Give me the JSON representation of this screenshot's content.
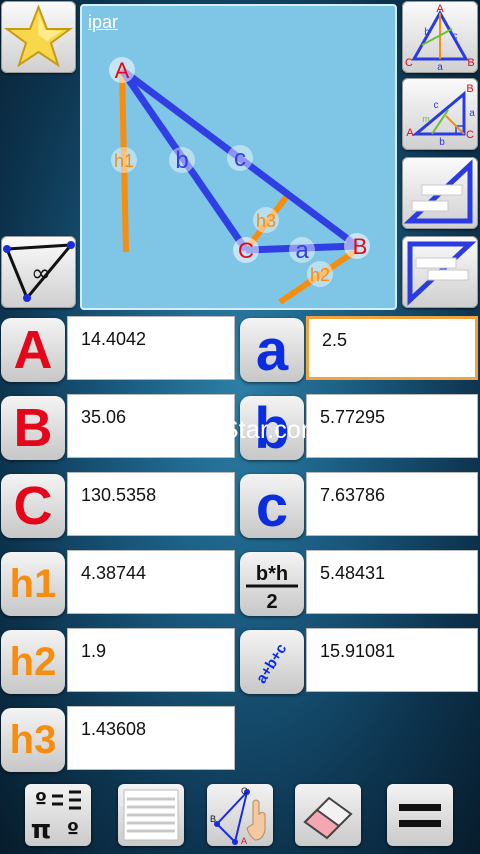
{
  "canvas": {
    "title": "ipar",
    "vertices": {
      "A": "A",
      "B": "B",
      "C": "C"
    },
    "sides": {
      "a": "a",
      "b": "b",
      "c": "c"
    },
    "heights": {
      "h1": "h1",
      "h2": "h2",
      "h3": "h3"
    }
  },
  "toolbar_right": {
    "triangle_labels": {
      "A": "A",
      "B": "B",
      "C": "C",
      "a": "a",
      "b": "b",
      "c": "c"
    },
    "right_triangle_labels": {
      "A": "A",
      "B": "B",
      "C": "C",
      "a": "a",
      "b": "b",
      "c": "c",
      "m": "m"
    }
  },
  "left_tool": {
    "infinity": "∞"
  },
  "rows": [
    {
      "left_label": "A",
      "left_value": "14.4042",
      "right_label": "a",
      "right_value": "2.5"
    },
    {
      "left_label": "B",
      "left_value": "35.06",
      "right_label": "b",
      "right_value": "5.77295"
    },
    {
      "left_label": "C",
      "left_value": "130.5358",
      "right_label": "c",
      "right_value": "7.63786"
    },
    {
      "left_label": "h1",
      "left_value": "4.38744",
      "right_value": "5.48431"
    },
    {
      "left_label": "h2",
      "left_value": "1.9",
      "right_value": "15.91081"
    },
    {
      "left_label": "h3",
      "left_value": "1.43608"
    }
  ],
  "area_formula": {
    "numerator": "b*h",
    "denominator": "2"
  },
  "perimeter_formula": "a+b+c",
  "watermark": "UpdateStar.com",
  "bottom_bar": {
    "degrees_symbol": "º",
    "pi_symbol": "π",
    "figure_labels": {
      "A": "A",
      "B": "B",
      "C": "C"
    }
  },
  "colors": {
    "red": "#e4061b",
    "blue": "#0a2de0",
    "orange": "#f78d0e",
    "active_border": "#f2a23a"
  }
}
